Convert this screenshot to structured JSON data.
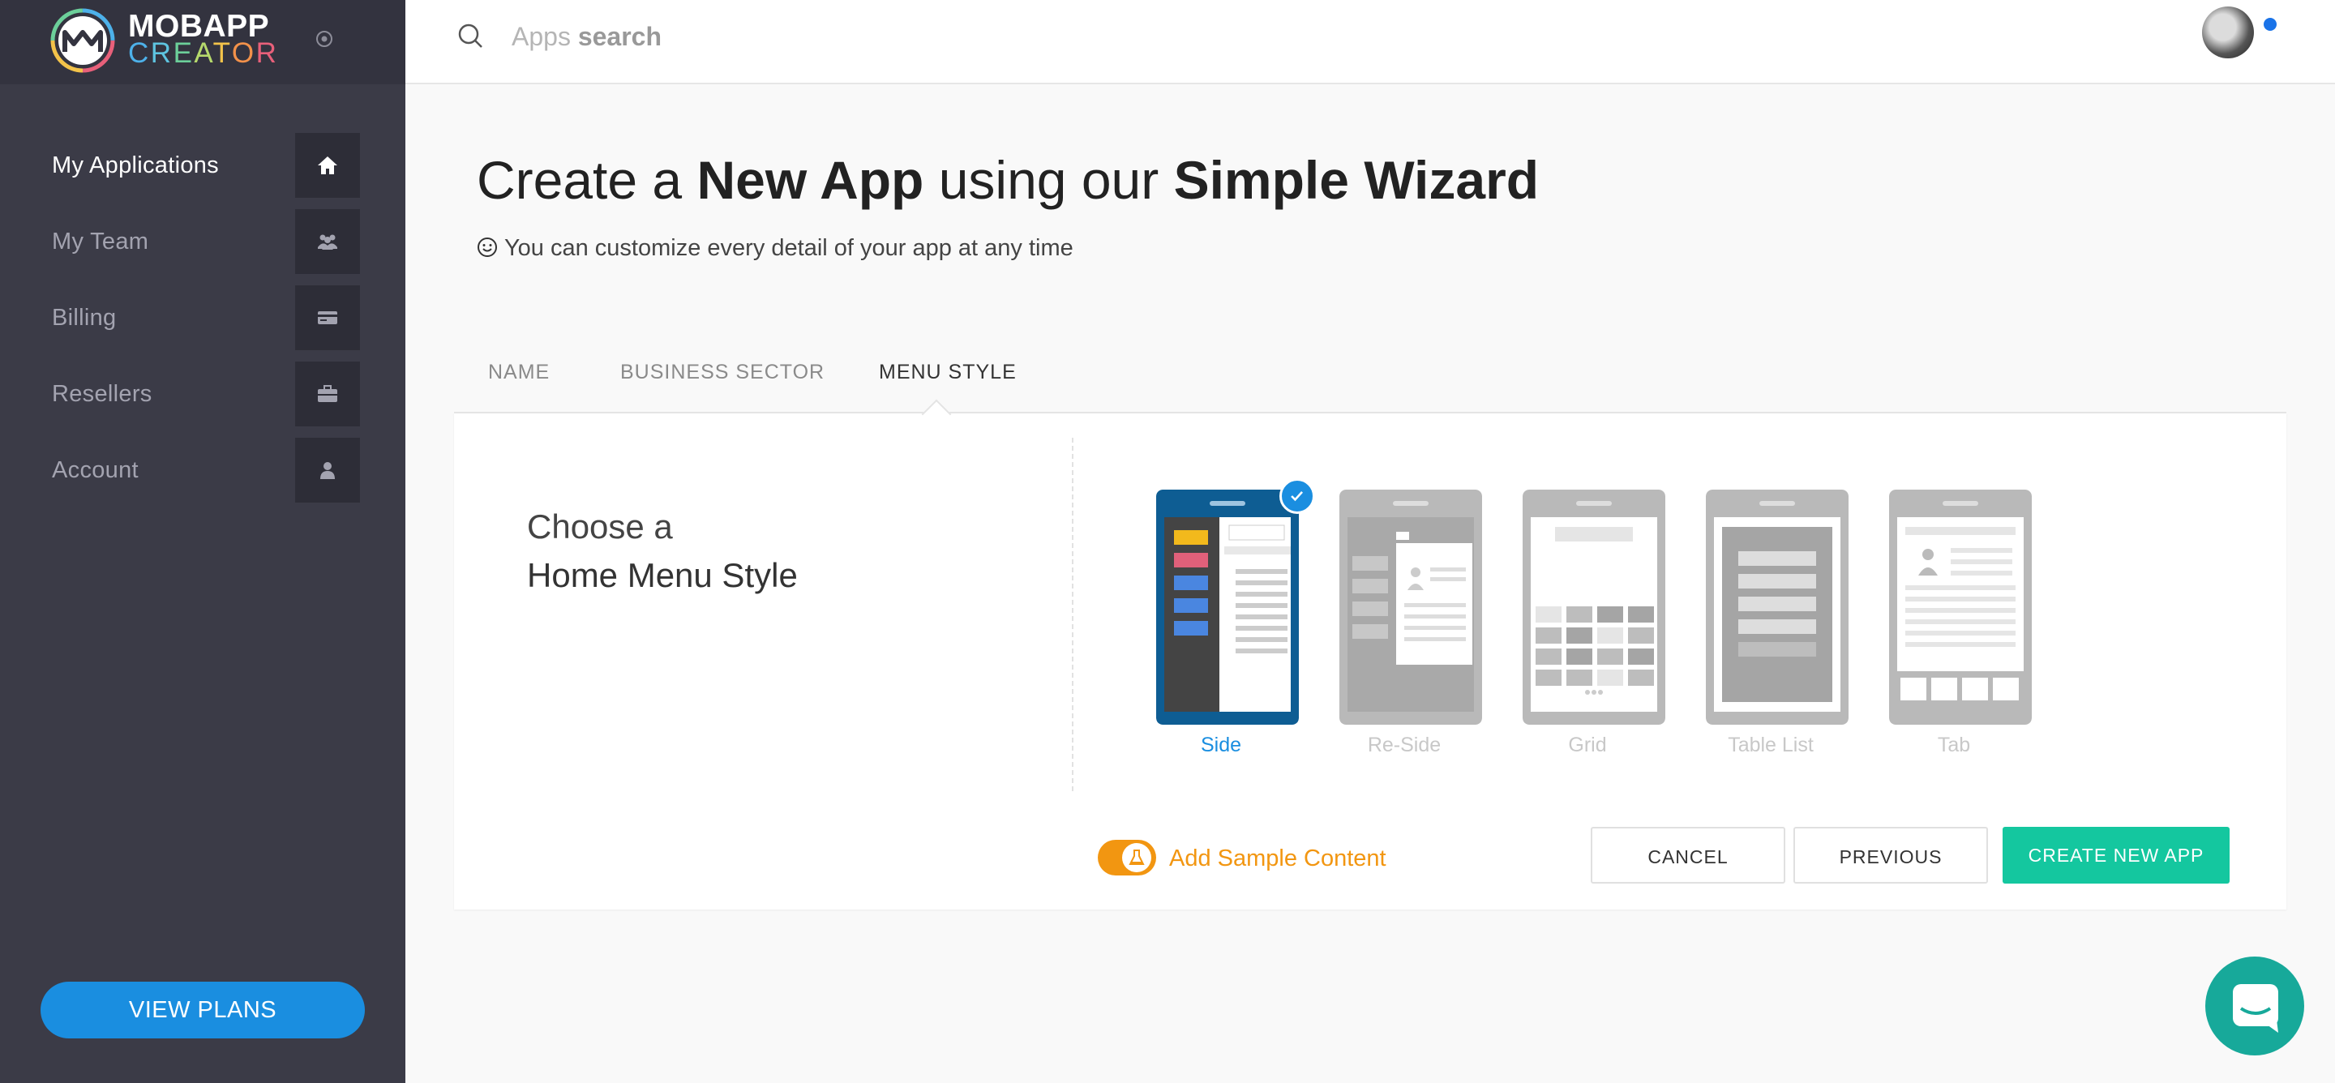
{
  "brand": {
    "title": "MOBAPP",
    "subtitle_letters": [
      "C",
      "R",
      "E",
      "A",
      "T",
      "O",
      "R"
    ]
  },
  "sidebar": {
    "items": [
      {
        "label": "My Applications",
        "icon": "home-icon",
        "active": true
      },
      {
        "label": "My Team",
        "icon": "team-icon",
        "active": false
      },
      {
        "label": "Billing",
        "icon": "credit-card-icon",
        "active": false
      },
      {
        "label": "Resellers",
        "icon": "briefcase-icon",
        "active": false
      },
      {
        "label": "Account",
        "icon": "user-icon",
        "active": false
      }
    ],
    "view_plans_label": "VIEW PLANS"
  },
  "topbar": {
    "search_light": "Apps",
    "search_bold": "search"
  },
  "main": {
    "title": {
      "p1": "Create a",
      "b1": "New App",
      "p2": "using our",
      "b2": "Simple Wizard"
    },
    "subtitle": "You can customize every detail of your app at any time",
    "tabs": [
      {
        "label": "NAME",
        "active": false
      },
      {
        "label": "BUSINESS SECTOR",
        "active": false
      },
      {
        "label": "MENU STYLE",
        "active": true
      }
    ],
    "choose": {
      "line1": "Choose a",
      "line2": "Home Menu Style"
    },
    "styles": [
      {
        "label": "Side",
        "selected": true
      },
      {
        "label": "Re-Side",
        "selected": false
      },
      {
        "label": "Grid",
        "selected": false
      },
      {
        "label": "Table List",
        "selected": false
      },
      {
        "label": "Tab",
        "selected": false
      }
    ],
    "sample_content": {
      "label": "Add Sample Content",
      "enabled": true
    },
    "buttons": {
      "cancel": "CANCEL",
      "previous": "PREVIOUS",
      "create": "CREATE NEW APP"
    }
  },
  "colors": {
    "sidebar_bg": "#3b3b47",
    "accent_blue": "#1a8ee0",
    "primary_green": "#14c79f",
    "toggle_orange": "#f29611",
    "chat_teal": "#17a99a"
  }
}
